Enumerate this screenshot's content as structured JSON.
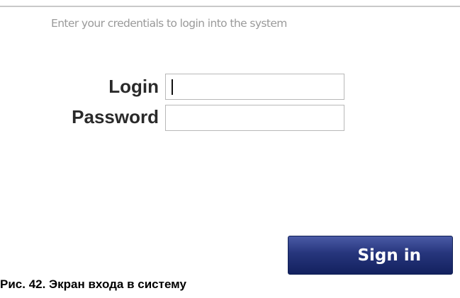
{
  "form": {
    "intro": "Enter your credentials to login into the system",
    "login_label": "Login",
    "login_value": "",
    "password_label": "Password",
    "password_value": "",
    "sign_in_label": "Sign in"
  },
  "caption": "Рис. 42. Экран входа в систему",
  "colors": {
    "button_top": "#4a5aa6",
    "button_bottom": "#13215f",
    "intro_text": "#9a9a9a",
    "label_text": "#2a2a2a"
  }
}
